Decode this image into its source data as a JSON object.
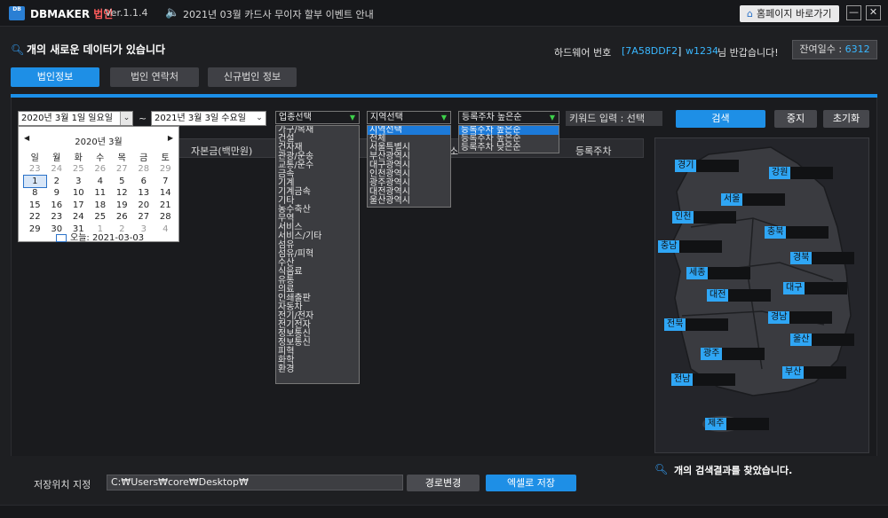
{
  "titlebar": {
    "logo": "DB",
    "app_name": "DBMAKER",
    "app_tag": "법인",
    "version": "Ver.1.1.4",
    "notice": "2021년 03월 카드사 무이자 할부 이벤트 안내",
    "home_button": "홈페이지 바로가기",
    "minimize": "—",
    "close": "✕"
  },
  "info": {
    "message": "개의 새로운 데이터가 있습니다",
    "hw_label": "하드웨어 번호",
    "hw_id": "[7A58DDF2]",
    "separator": "|",
    "user": "w1234",
    "welcome": "님 반갑습니다!",
    "remain_label": "잔여일수 : ",
    "remain_value": "6312"
  },
  "tabs": [
    {
      "label": "법인정보",
      "active": true
    },
    {
      "label": "법인 연락처",
      "active": false
    },
    {
      "label": "신규법인 정보",
      "active": false
    }
  ],
  "filters": {
    "date_from": "2020년   3월   1일 일요일",
    "tilde": "~",
    "date_to": "2021년   3월   3일 수요일",
    "industry": "업종선택",
    "region": "지역선택",
    "sort": "등록주차 높은순",
    "keyword": "키워드 입력 : 선택"
  },
  "buttons": {
    "search": "검색",
    "stop": "중지",
    "reset": "초기화",
    "change_path": "경로변경",
    "save_excel": "엑셀로 저장"
  },
  "table_headers": [
    "자본금(백만원)",
    "소",
    "등록주차"
  ],
  "calendar": {
    "month_label": "2020년 3월",
    "prev": "◀",
    "next": "▶",
    "weekdays": [
      "일",
      "월",
      "화",
      "수",
      "목",
      "금",
      "토"
    ],
    "weeks": [
      [
        "23",
        "24",
        "25",
        "26",
        "27",
        "28",
        "29"
      ],
      [
        "1",
        "2",
        "3",
        "4",
        "5",
        "6",
        "7"
      ],
      [
        "8",
        "9",
        "10",
        "11",
        "12",
        "13",
        "14"
      ],
      [
        "15",
        "16",
        "17",
        "18",
        "19",
        "20",
        "21"
      ],
      [
        "22",
        "23",
        "24",
        "25",
        "26",
        "27",
        "28"
      ],
      [
        "29",
        "30",
        "31",
        "1",
        "2",
        "3",
        "4"
      ]
    ],
    "today_label": "오늘: 2021-03-03"
  },
  "industry_options": [
    "가구/목재",
    "건설",
    "건자재",
    "관광/운송",
    "교통/운수",
    "금속",
    "기계",
    "기계금속",
    "기타",
    "농수축산",
    "무역",
    "서비스",
    "서비스/기타",
    "섬유",
    "섬유/피혁",
    "수산",
    "식음료",
    "유통",
    "의료",
    "인쇄출판",
    "자동차",
    "전기/전자",
    "전기전자",
    "정보통신",
    "정보통신",
    "피혁",
    "화학",
    "환경"
  ],
  "region_options": [
    "지역선택",
    "전체",
    "서울특별시",
    "부산광역시",
    "대구광역시",
    "인천광역시",
    "광주광역시",
    "대전광역시",
    "울산광역시"
  ],
  "sort_options": [
    "등록주차 높은순",
    "등록주차 높은순",
    "등록주차 낮은순"
  ],
  "map_regions": [
    "경기",
    "강원",
    "서울",
    "인천",
    "충북",
    "충남",
    "경북",
    "세종",
    "대구",
    "대전",
    "경남",
    "전북",
    "울산",
    "광주",
    "부산",
    "전남",
    "제주"
  ],
  "result_message": "개의 검색결과를 찾았습니다.",
  "save": {
    "label": "저장위치 지정",
    "path": "C:₩Users₩core₩Desktop₩"
  }
}
